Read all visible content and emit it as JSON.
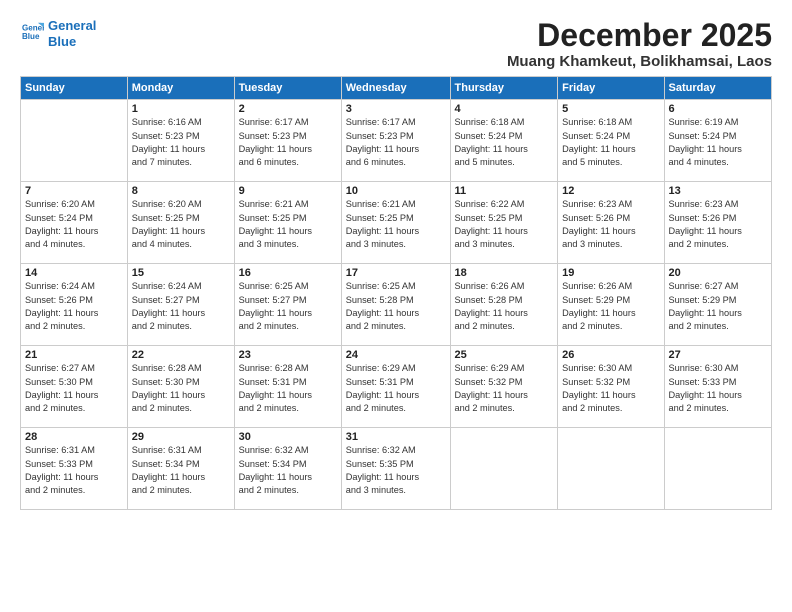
{
  "logo": {
    "line1": "General",
    "line2": "Blue"
  },
  "title": "December 2025",
  "location": "Muang Khamkeut, Bolikhamsai, Laos",
  "days_of_week": [
    "Sunday",
    "Monday",
    "Tuesday",
    "Wednesday",
    "Thursday",
    "Friday",
    "Saturday"
  ],
  "weeks": [
    [
      {
        "day": "",
        "info": ""
      },
      {
        "day": "1",
        "info": "Sunrise: 6:16 AM\nSunset: 5:23 PM\nDaylight: 11 hours\nand 7 minutes."
      },
      {
        "day": "2",
        "info": "Sunrise: 6:17 AM\nSunset: 5:23 PM\nDaylight: 11 hours\nand 6 minutes."
      },
      {
        "day": "3",
        "info": "Sunrise: 6:17 AM\nSunset: 5:23 PM\nDaylight: 11 hours\nand 6 minutes."
      },
      {
        "day": "4",
        "info": "Sunrise: 6:18 AM\nSunset: 5:24 PM\nDaylight: 11 hours\nand 5 minutes."
      },
      {
        "day": "5",
        "info": "Sunrise: 6:18 AM\nSunset: 5:24 PM\nDaylight: 11 hours\nand 5 minutes."
      },
      {
        "day": "6",
        "info": "Sunrise: 6:19 AM\nSunset: 5:24 PM\nDaylight: 11 hours\nand 4 minutes."
      }
    ],
    [
      {
        "day": "7",
        "info": "Sunrise: 6:20 AM\nSunset: 5:24 PM\nDaylight: 11 hours\nand 4 minutes."
      },
      {
        "day": "8",
        "info": "Sunrise: 6:20 AM\nSunset: 5:25 PM\nDaylight: 11 hours\nand 4 minutes."
      },
      {
        "day": "9",
        "info": "Sunrise: 6:21 AM\nSunset: 5:25 PM\nDaylight: 11 hours\nand 3 minutes."
      },
      {
        "day": "10",
        "info": "Sunrise: 6:21 AM\nSunset: 5:25 PM\nDaylight: 11 hours\nand 3 minutes."
      },
      {
        "day": "11",
        "info": "Sunrise: 6:22 AM\nSunset: 5:25 PM\nDaylight: 11 hours\nand 3 minutes."
      },
      {
        "day": "12",
        "info": "Sunrise: 6:23 AM\nSunset: 5:26 PM\nDaylight: 11 hours\nand 3 minutes."
      },
      {
        "day": "13",
        "info": "Sunrise: 6:23 AM\nSunset: 5:26 PM\nDaylight: 11 hours\nand 2 minutes."
      }
    ],
    [
      {
        "day": "14",
        "info": "Sunrise: 6:24 AM\nSunset: 5:26 PM\nDaylight: 11 hours\nand 2 minutes."
      },
      {
        "day": "15",
        "info": "Sunrise: 6:24 AM\nSunset: 5:27 PM\nDaylight: 11 hours\nand 2 minutes."
      },
      {
        "day": "16",
        "info": "Sunrise: 6:25 AM\nSunset: 5:27 PM\nDaylight: 11 hours\nand 2 minutes."
      },
      {
        "day": "17",
        "info": "Sunrise: 6:25 AM\nSunset: 5:28 PM\nDaylight: 11 hours\nand 2 minutes."
      },
      {
        "day": "18",
        "info": "Sunrise: 6:26 AM\nSunset: 5:28 PM\nDaylight: 11 hours\nand 2 minutes."
      },
      {
        "day": "19",
        "info": "Sunrise: 6:26 AM\nSunset: 5:29 PM\nDaylight: 11 hours\nand 2 minutes."
      },
      {
        "day": "20",
        "info": "Sunrise: 6:27 AM\nSunset: 5:29 PM\nDaylight: 11 hours\nand 2 minutes."
      }
    ],
    [
      {
        "day": "21",
        "info": "Sunrise: 6:27 AM\nSunset: 5:30 PM\nDaylight: 11 hours\nand 2 minutes."
      },
      {
        "day": "22",
        "info": "Sunrise: 6:28 AM\nSunset: 5:30 PM\nDaylight: 11 hours\nand 2 minutes."
      },
      {
        "day": "23",
        "info": "Sunrise: 6:28 AM\nSunset: 5:31 PM\nDaylight: 11 hours\nand 2 minutes."
      },
      {
        "day": "24",
        "info": "Sunrise: 6:29 AM\nSunset: 5:31 PM\nDaylight: 11 hours\nand 2 minutes."
      },
      {
        "day": "25",
        "info": "Sunrise: 6:29 AM\nSunset: 5:32 PM\nDaylight: 11 hours\nand 2 minutes."
      },
      {
        "day": "26",
        "info": "Sunrise: 6:30 AM\nSunset: 5:32 PM\nDaylight: 11 hours\nand 2 minutes."
      },
      {
        "day": "27",
        "info": "Sunrise: 6:30 AM\nSunset: 5:33 PM\nDaylight: 11 hours\nand 2 minutes."
      }
    ],
    [
      {
        "day": "28",
        "info": "Sunrise: 6:31 AM\nSunset: 5:33 PM\nDaylight: 11 hours\nand 2 minutes."
      },
      {
        "day": "29",
        "info": "Sunrise: 6:31 AM\nSunset: 5:34 PM\nDaylight: 11 hours\nand 2 minutes."
      },
      {
        "day": "30",
        "info": "Sunrise: 6:32 AM\nSunset: 5:34 PM\nDaylight: 11 hours\nand 2 minutes."
      },
      {
        "day": "31",
        "info": "Sunrise: 6:32 AM\nSunset: 5:35 PM\nDaylight: 11 hours\nand 3 minutes."
      },
      {
        "day": "",
        "info": ""
      },
      {
        "day": "",
        "info": ""
      },
      {
        "day": "",
        "info": ""
      }
    ]
  ]
}
